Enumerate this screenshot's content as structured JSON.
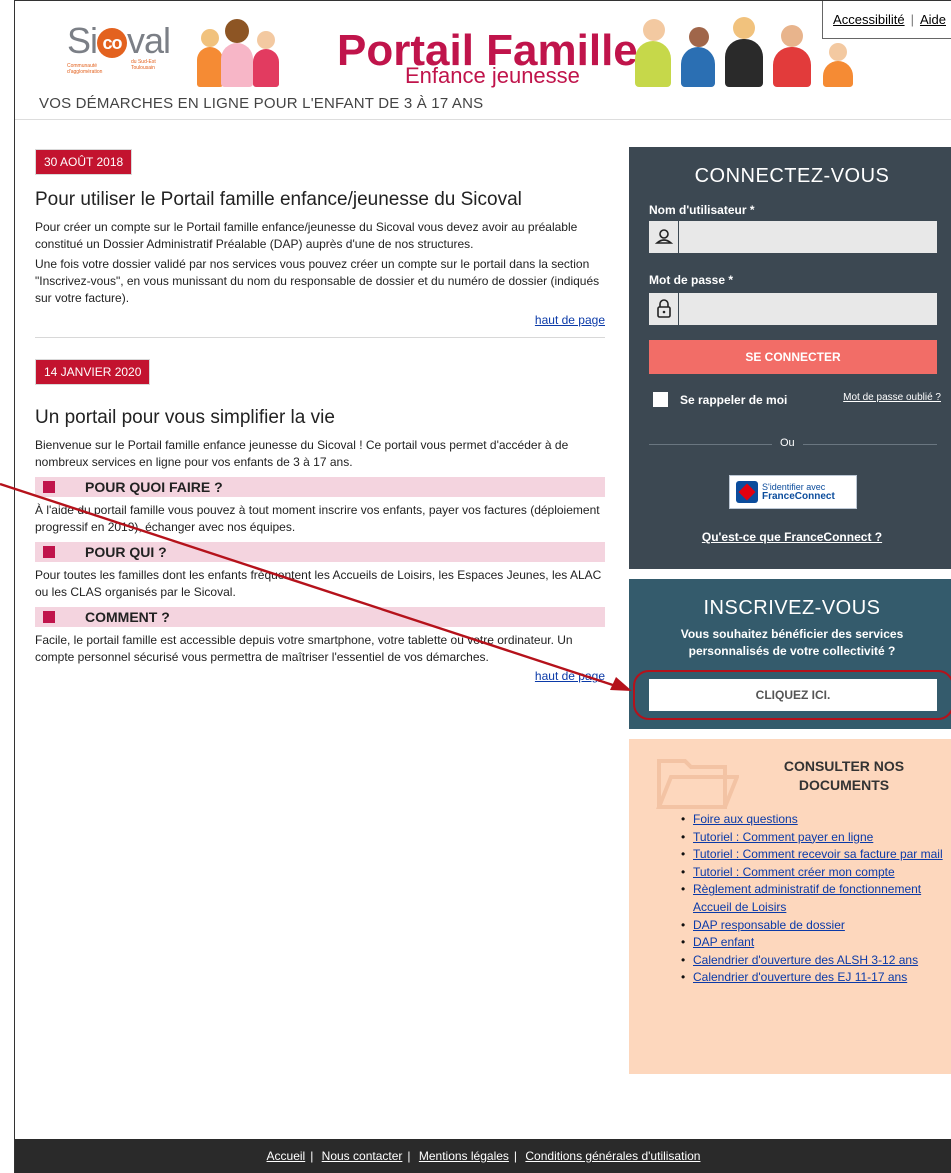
{
  "header": {
    "logo": {
      "main": "Sicoval",
      "sub_left": "Communauté d'agglomération",
      "sub_right": "du Sud-Est Toulousain"
    },
    "title": "Portail Famille",
    "subtitle": "Enfance jeunesse",
    "links": {
      "accessibility": "Accessibilité",
      "separator": "|",
      "help": "Aide"
    }
  },
  "tagline": "VOS DÉMARCHES EN LIGNE POUR L'ENFANT DE 3 À 17 ANS",
  "news": [
    {
      "date": "30 AOÛT 2018",
      "title": "Pour utiliser le Portail famille enfance/jeunesse du Sicoval",
      "paragraphs": [
        "Pour créer un compte sur le Portail famille enfance/jeunesse du Sicoval vous devez avoir au préalable constitué un Dossier Administratif Préalable (DAP) auprès d'une de nos structures.",
        "Une fois votre dossier validé par nos services vous pouvez créer un compte sur le portail dans la section \"Inscrivez-vous\", en vous munissant du nom du responsable de dossier et du numéro de dossier (indiqués sur votre facture)."
      ],
      "top_link": "haut de page"
    },
    {
      "date": "14 JANVIER 2020",
      "title": "Un portail pour vous simplifier la vie",
      "intro": "Bienvenue sur le Portail famille enfance jeunesse du Sicoval ! Ce portail vous permet d'accéder à de nombreux services en ligne pour vos enfants de 3 à 17 ans.",
      "sections": [
        {
          "heading": "POUR QUOI FAIRE ?",
          "text": "À l'aide du portail famille vous pouvez à tout moment inscrire vos enfants, payer vos factures (déploiement progressif en 2019), échanger avec nos équipes."
        },
        {
          "heading": "POUR QUI ?",
          "text": "Pour toutes les familles dont les enfants fréquentent les Accueils de Loisirs, les Espaces Jeunes, les ALAC ou les CLAS organisés par le Sicoval."
        },
        {
          "heading": "COMMENT ?",
          "text": "Facile, le portail famille est accessible depuis votre smartphone, votre tablette ou votre ordinateur. Un compte personnel sécurisé vous permettra de maîtriser l'essentiel de vos démarches."
        }
      ],
      "top_link": "haut de page"
    }
  ],
  "login": {
    "title": "CONNECTEZ-VOUS",
    "username_label": "Nom d'utilisateur *",
    "username_value": "",
    "password_label": "Mot de passe *",
    "password_value": "",
    "submit": "SE CONNECTER",
    "remember": "Se rappeler de moi",
    "forgot": "Mot de passe oublié ?",
    "or": "Ou",
    "fc_line1": "S'identifier avec",
    "fc_line2": "FranceConnect",
    "fc_what": "Qu'est-ce que FranceConnect ?"
  },
  "register": {
    "title": "INSCRIVEZ-VOUS",
    "text": "Vous souhaitez bénéficier des services personnalisés de votre collectivité ?",
    "button": "CLIQUEZ ICI."
  },
  "docs": {
    "title": "CONSULTER NOS DOCUMENTS",
    "items": [
      "Foire aux questions",
      "Tutoriel : Comment payer en ligne",
      "Tutoriel : Comment recevoir sa facture par mail",
      "Tutoriel : Comment créer mon compte",
      "Règlement administratif de fonctionnement Accueil de Loisirs",
      "DAP responsable de dossier",
      "DAP enfant",
      "Calendrier d'ouverture des ALSH 3-12 ans",
      "Calendrier d'ouverture des EJ 11-17 ans"
    ]
  },
  "footer": {
    "links": [
      "Accueil",
      "Nous contacter",
      "Mentions légales",
      "Conditions générales d'utilisation"
    ]
  },
  "colors": {
    "brand": "#c0144b",
    "login_bg": "#3c4852",
    "register_bg": "#345b6c",
    "docs_bg": "#fdd7bd",
    "connect_btn": "#f26d67",
    "annotation": "#b5121b"
  }
}
